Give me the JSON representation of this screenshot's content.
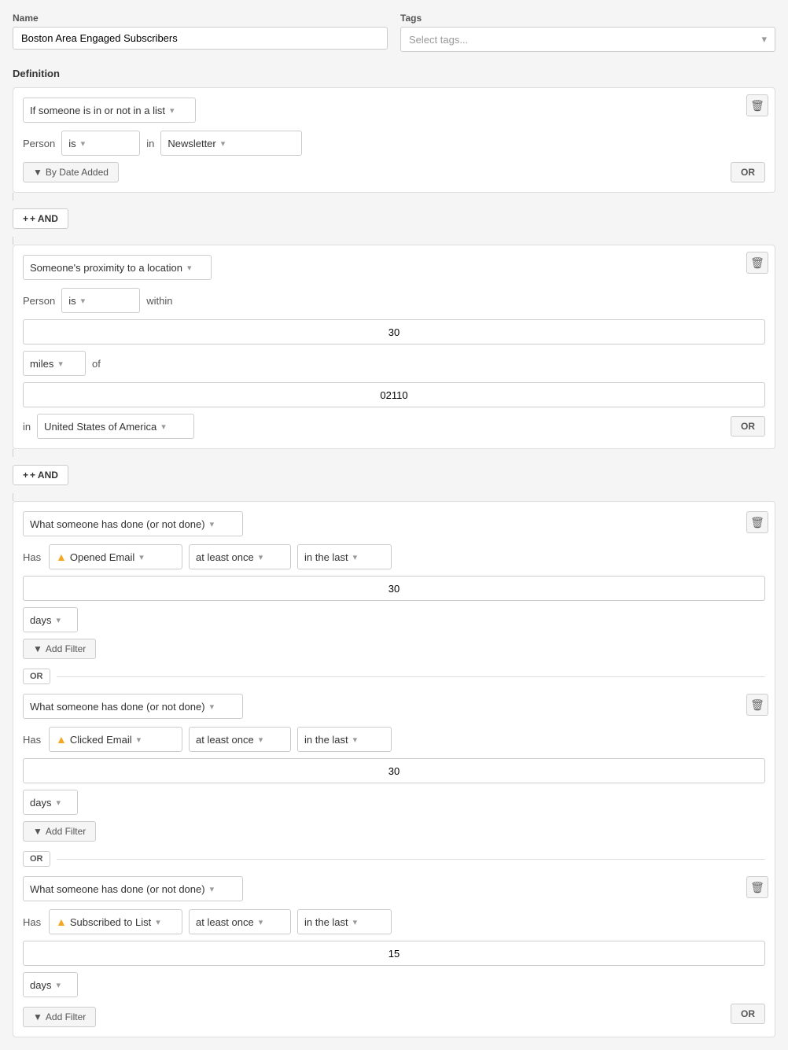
{
  "name_label": "Name",
  "name_value": "Boston Area Engaged Subscribers",
  "tags_label": "Tags",
  "tags_placeholder": "Select tags...",
  "definition_label": "Definition",
  "condition1": {
    "type": "If someone is in or not in a list",
    "person_label": "Person",
    "person_is": "is",
    "in_label": "in",
    "list_value": "Newsletter",
    "by_date_label": "By Date Added",
    "or_label": "OR",
    "delete_icon": "🗑"
  },
  "and1_label": "+ AND",
  "condition2": {
    "type": "Someone's proximity to a location",
    "person_label": "Person",
    "person_is": "is",
    "within_label": "within",
    "distance_value": "30",
    "units_value": "miles",
    "of_label": "of",
    "zip_value": "02110",
    "in_label": "in",
    "country_value": "United States of America",
    "or_label": "OR",
    "delete_icon": "🗑"
  },
  "and2_label": "+ AND",
  "condition3": {
    "type": "What someone has done (or not done)",
    "has_label": "Has",
    "action1": "Opened Email",
    "freq1": "at least once",
    "time1": "in the last",
    "days1_value": "30",
    "unit1": "days",
    "add_filter_label": "Add Filter",
    "delete_icon": "🗑",
    "or_label": "OR"
  },
  "condition4": {
    "type": "What someone has done (or not done)",
    "has_label": "Has",
    "action1": "Clicked Email",
    "freq1": "at least once",
    "time1": "in the last",
    "days1_value": "30",
    "unit1": "days",
    "add_filter_label": "Add Filter",
    "delete_icon": "🗑",
    "or_label": "OR"
  },
  "condition5": {
    "type": "What someone has done (or not done)",
    "has_label": "Has",
    "action1": "Subscribed to List",
    "freq1": "at least once",
    "time1": "in the last",
    "days1_value": "15",
    "unit1": "days",
    "add_filter_label": "Add Filter",
    "delete_icon": "🗑",
    "or_label": "OR"
  }
}
